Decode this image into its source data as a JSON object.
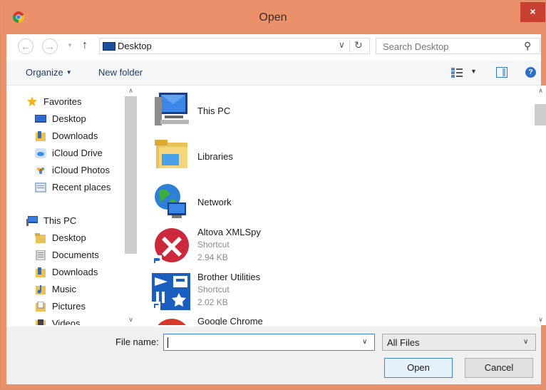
{
  "window": {
    "title": "Open",
    "close_label": "×"
  },
  "nav": {
    "back_icon": "arrow-left-icon",
    "forward_icon": "arrow-right-icon",
    "up_icon": "arrow-up-icon",
    "address": "Desktop",
    "search_placeholder": "Search Desktop"
  },
  "commandbar": {
    "organize_label": "Organize",
    "new_folder_label": "New folder"
  },
  "sidebar": {
    "favorites_label": "Favorites",
    "favorites": [
      {
        "label": "Desktop",
        "icon": "desktop-icon"
      },
      {
        "label": "Downloads",
        "icon": "downloads-icon"
      },
      {
        "label": "iCloud Drive",
        "icon": "icloud-drive-icon"
      },
      {
        "label": "iCloud Photos",
        "icon": "icloud-photos-icon"
      },
      {
        "label": "Recent places",
        "icon": "recent-places-icon"
      }
    ],
    "thispc_label": "This PC",
    "thispc": [
      {
        "label": "Desktop",
        "icon": "desktop-folder-icon"
      },
      {
        "label": "Documents",
        "icon": "documents-icon"
      },
      {
        "label": "Downloads",
        "icon": "downloads-icon"
      },
      {
        "label": "Music",
        "icon": "music-icon"
      },
      {
        "label": "Pictures",
        "icon": "pictures-icon"
      },
      {
        "label": "Videos",
        "icon": "videos-icon"
      }
    ]
  },
  "files": [
    {
      "name": "This PC",
      "type": "",
      "size": "",
      "icon": "computer-icon"
    },
    {
      "name": "Libraries",
      "type": "",
      "size": "",
      "icon": "libraries-icon"
    },
    {
      "name": "Network",
      "type": "",
      "size": "",
      "icon": "network-icon"
    },
    {
      "name": "Altova XMLSpy",
      "type": "Shortcut",
      "size": "2.94 KB",
      "icon": "xmlspy-icon"
    },
    {
      "name": "Brother Utilities",
      "type": "Shortcut",
      "size": "2.02 KB",
      "icon": "brother-utilities-icon"
    },
    {
      "name": "Google Chrome",
      "type": "",
      "size": "",
      "icon": "chrome-icon"
    }
  ],
  "footer": {
    "filename_label": "File name:",
    "filename_value": "",
    "filetype_value": "All Files",
    "open_label": "Open",
    "cancel_label": "Cancel"
  }
}
